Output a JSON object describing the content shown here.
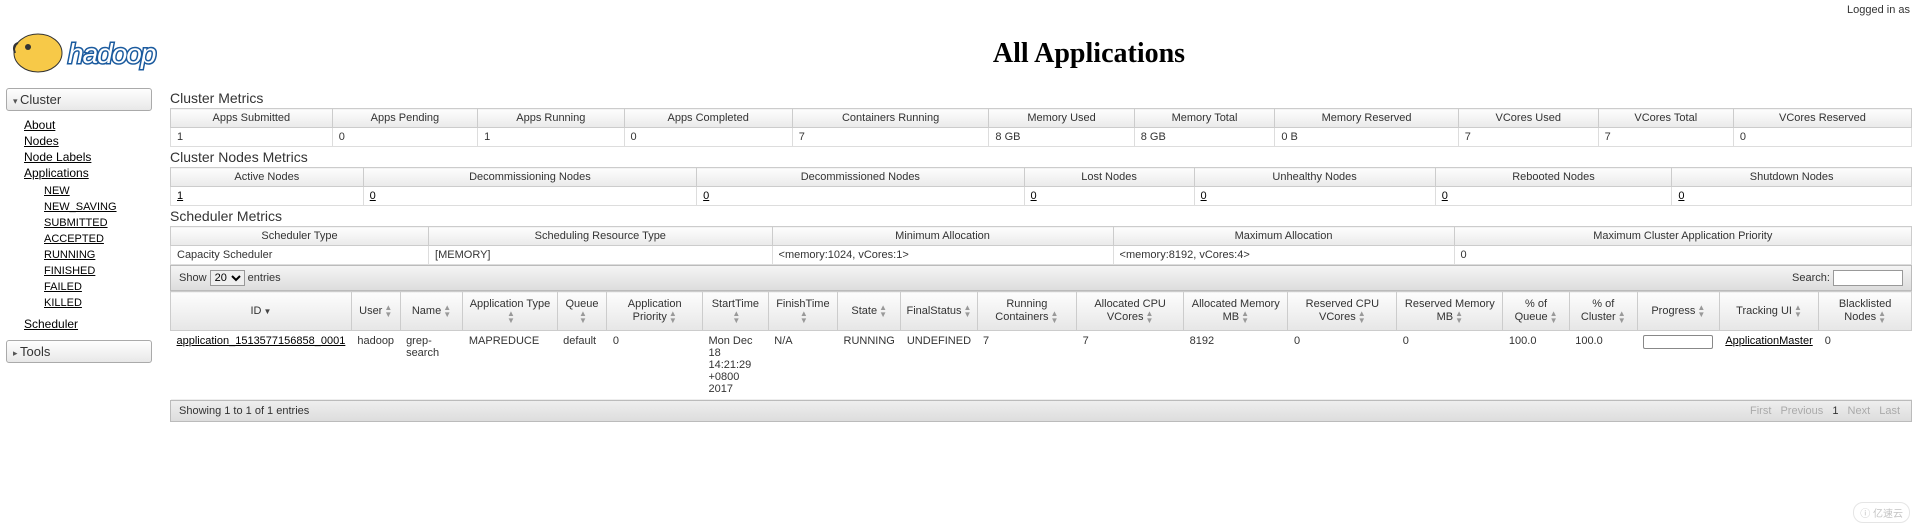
{
  "header": {
    "logged_in": "Logged in as",
    "page_title": "All Applications",
    "logo_text": "hadoop"
  },
  "sidebar": {
    "cluster_label": "Cluster",
    "tools_label": "Tools",
    "links": {
      "about": "About",
      "nodes": "Nodes",
      "node_labels": "Node Labels",
      "applications": "Applications",
      "scheduler": "Scheduler"
    },
    "app_states": {
      "new": "NEW",
      "new_saving": "NEW_SAVING",
      "submitted": "SUBMITTED",
      "accepted": "ACCEPTED",
      "running": "RUNNING",
      "finished": "FINISHED",
      "failed": "FAILED",
      "killed": "KILLED"
    }
  },
  "cluster_metrics": {
    "title": "Cluster Metrics",
    "headers": [
      "Apps Submitted",
      "Apps Pending",
      "Apps Running",
      "Apps Completed",
      "Containers Running",
      "Memory Used",
      "Memory Total",
      "Memory Reserved",
      "VCores Used",
      "VCores Total",
      "VCores Reserved"
    ],
    "values": [
      "1",
      "0",
      "1",
      "0",
      "7",
      "8 GB",
      "8 GB",
      "0 B",
      "7",
      "7",
      "0"
    ]
  },
  "nodes_metrics": {
    "title": "Cluster Nodes Metrics",
    "headers": [
      "Active Nodes",
      "Decommissioning Nodes",
      "Decommissioned Nodes",
      "Lost Nodes",
      "Unhealthy Nodes",
      "Rebooted Nodes",
      "Shutdown Nodes"
    ],
    "values": [
      "1",
      "0",
      "0",
      "0",
      "0",
      "0",
      "0"
    ]
  },
  "scheduler_metrics": {
    "title": "Scheduler Metrics",
    "headers": [
      "Scheduler Type",
      "Scheduling Resource Type",
      "Minimum Allocation",
      "Maximum Allocation",
      "Maximum Cluster Application Priority"
    ],
    "values": [
      "Capacity Scheduler",
      "[MEMORY]",
      "<memory:1024, vCores:1>",
      "<memory:8192, vCores:4>",
      "0"
    ]
  },
  "datatable": {
    "show_label": "Show",
    "entries_label": "entries",
    "length_options": [
      "20"
    ],
    "search_label": "Search:",
    "columns": [
      "ID",
      "User",
      "Name",
      "Application Type",
      "Queue",
      "Application Priority",
      "StartTime",
      "FinishTime",
      "State",
      "FinalStatus",
      "Running Containers",
      "Allocated CPU VCores",
      "Allocated Memory MB",
      "Reserved CPU VCores",
      "Reserved Memory MB",
      "% of Queue",
      "% of Cluster",
      "Progress",
      "Tracking UI",
      "Blacklisted Nodes"
    ],
    "rows": [
      {
        "id": "application_1513577156858_0001",
        "user": "hadoop",
        "name": "grep-search",
        "type": "MAPREDUCE",
        "queue": "default",
        "priority": "0",
        "start": "Mon Dec 18 14:21:29 +0800 2017",
        "finish": "N/A",
        "state": "RUNNING",
        "final": "UNDEFINED",
        "running_containers": "7",
        "alloc_vcores": "7",
        "alloc_mem": "8192",
        "res_vcores": "0",
        "res_mem": "0",
        "pct_queue": "100.0",
        "pct_cluster": "100.0",
        "tracking": "ApplicationMaster",
        "blacklisted": "0"
      }
    ],
    "info": "Showing 1 to 1 of 1 entries",
    "pager": {
      "first": "First",
      "prev": "Previous",
      "next": "Next",
      "last": "Last",
      "page": "1"
    }
  },
  "watermark": "亿速云"
}
